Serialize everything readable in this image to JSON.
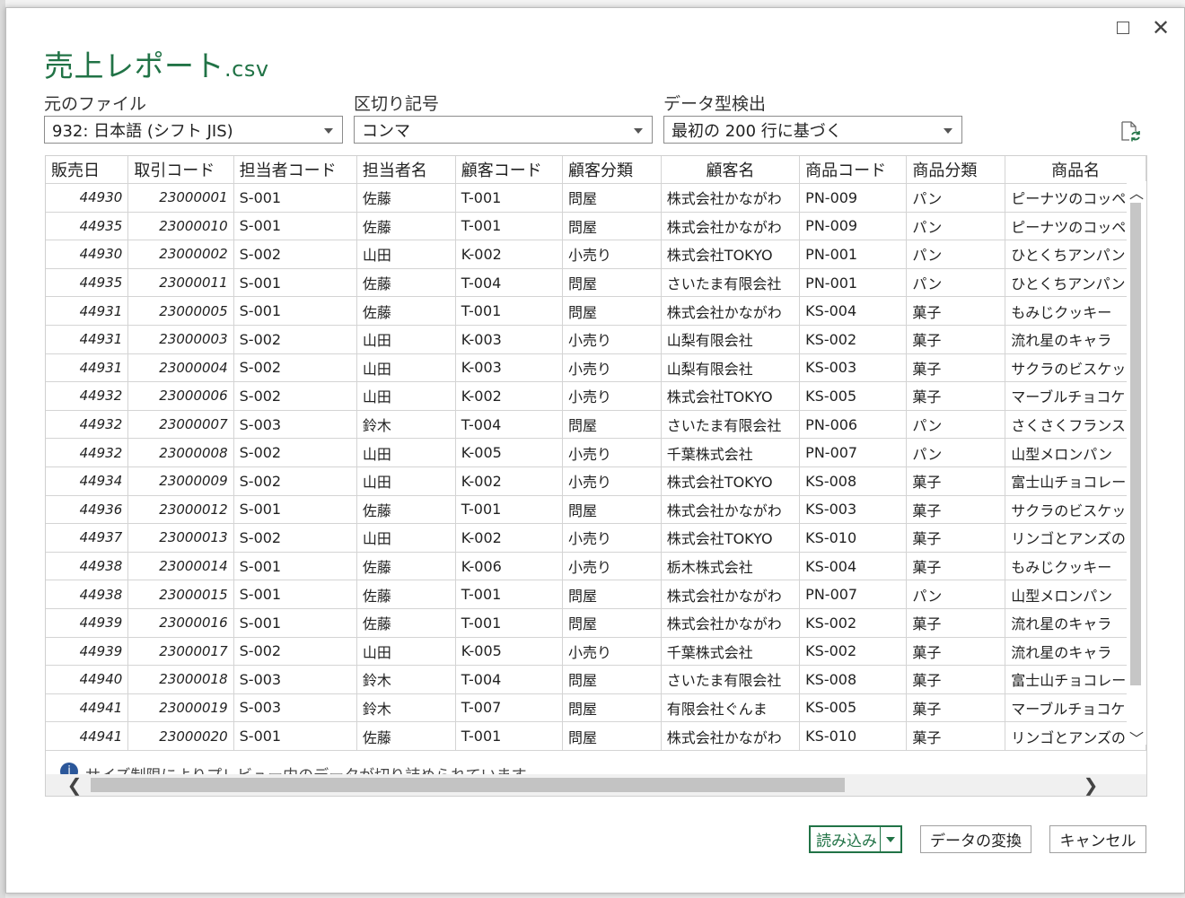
{
  "dialog": {
    "title": "売上レポート",
    "title_ext": ".csv",
    "accent_color": "#217346"
  },
  "fields": {
    "source_label": "元のファイル",
    "source_value": "932: 日本語 (シフト JIS)",
    "delimiter_label": "区切り記号",
    "delimiter_value": "コンマ",
    "detect_label": "データ型検出",
    "detect_value": "最初の 200 行に基づく"
  },
  "table": {
    "headers": [
      "販売日",
      "取引コード",
      "担当者コード",
      "担当者名",
      "顧客コード",
      "顧客分類",
      "顧客名",
      "商品コード",
      "商品分類",
      "商品名"
    ],
    "rows": [
      [
        "44930",
        "23000001",
        "S-001",
        "佐藤",
        "T-001",
        "問屋",
        "株式会社かながわ",
        "PN-009",
        "パン",
        "ピーナツのコッペ"
      ],
      [
        "44935",
        "23000010",
        "S-001",
        "佐藤",
        "T-001",
        "問屋",
        "株式会社かながわ",
        "PN-009",
        "パン",
        "ピーナツのコッペ"
      ],
      [
        "44930",
        "23000002",
        "S-002",
        "山田",
        "K-002",
        "小売り",
        "株式会社TOKYO",
        "PN-001",
        "パン",
        "ひとくちアンパン"
      ],
      [
        "44935",
        "23000011",
        "S-001",
        "佐藤",
        "T-004",
        "問屋",
        "さいたま有限会社",
        "PN-001",
        "パン",
        "ひとくちアンパン"
      ],
      [
        "44931",
        "23000005",
        "S-001",
        "佐藤",
        "T-001",
        "問屋",
        "株式会社かながわ",
        "KS-004",
        "菓子",
        "もみじクッキー"
      ],
      [
        "44931",
        "23000003",
        "S-002",
        "山田",
        "K-003",
        "小売り",
        "山梨有限会社",
        "KS-002",
        "菓子",
        "流れ星のキャラ"
      ],
      [
        "44931",
        "23000004",
        "S-002",
        "山田",
        "K-003",
        "小売り",
        "山梨有限会社",
        "KS-003",
        "菓子",
        "サクラのビスケッ"
      ],
      [
        "44932",
        "23000006",
        "S-002",
        "山田",
        "K-002",
        "小売り",
        "株式会社TOKYO",
        "KS-005",
        "菓子",
        "マーブルチョコケ"
      ],
      [
        "44932",
        "23000007",
        "S-003",
        "鈴木",
        "T-004",
        "問屋",
        "さいたま有限会社",
        "PN-006",
        "パン",
        "さくさくフランスパ"
      ],
      [
        "44932",
        "23000008",
        "S-002",
        "山田",
        "K-005",
        "小売り",
        "千葉株式会社",
        "PN-007",
        "パン",
        "山型メロンパン"
      ],
      [
        "44934",
        "23000009",
        "S-002",
        "山田",
        "K-002",
        "小売り",
        "株式会社TOKYO",
        "KS-008",
        "菓子",
        "富士山チョコレー"
      ],
      [
        "44936",
        "23000012",
        "S-001",
        "佐藤",
        "T-001",
        "問屋",
        "株式会社かながわ",
        "KS-003",
        "菓子",
        "サクラのビスケッ"
      ],
      [
        "44937",
        "23000013",
        "S-002",
        "山田",
        "K-002",
        "小売り",
        "株式会社TOKYO",
        "KS-010",
        "菓子",
        "リンゴとアンズの"
      ],
      [
        "44938",
        "23000014",
        "S-001",
        "佐藤",
        "K-006",
        "小売り",
        "栃木株式会社",
        "KS-004",
        "菓子",
        "もみじクッキー"
      ],
      [
        "44938",
        "23000015",
        "S-001",
        "佐藤",
        "T-001",
        "問屋",
        "株式会社かながわ",
        "PN-007",
        "パン",
        "山型メロンパン"
      ],
      [
        "44939",
        "23000016",
        "S-001",
        "佐藤",
        "T-001",
        "問屋",
        "株式会社かながわ",
        "KS-002",
        "菓子",
        "流れ星のキャラ"
      ],
      [
        "44939",
        "23000017",
        "S-002",
        "山田",
        "K-005",
        "小売り",
        "千葉株式会社",
        "KS-002",
        "菓子",
        "流れ星のキャラ"
      ],
      [
        "44940",
        "23000018",
        "S-003",
        "鈴木",
        "T-004",
        "問屋",
        "さいたま有限会社",
        "KS-008",
        "菓子",
        "富士山チョコレー"
      ],
      [
        "44941",
        "23000019",
        "S-003",
        "鈴木",
        "T-007",
        "問屋",
        "有限会社ぐんま",
        "KS-005",
        "菓子",
        "マーブルチョコケ"
      ],
      [
        "44941",
        "23000020",
        "S-001",
        "佐藤",
        "T-001",
        "問屋",
        "株式会社かながわ",
        "KS-010",
        "菓子",
        "リンゴとアンズの"
      ]
    ]
  },
  "notice": {
    "icon": "info-icon",
    "text": "サイズ制限によりプレビュー内のデータが切り詰められています。"
  },
  "buttons": {
    "load": "読み込み",
    "transform": "データの変換",
    "cancel": "キャンセル"
  }
}
